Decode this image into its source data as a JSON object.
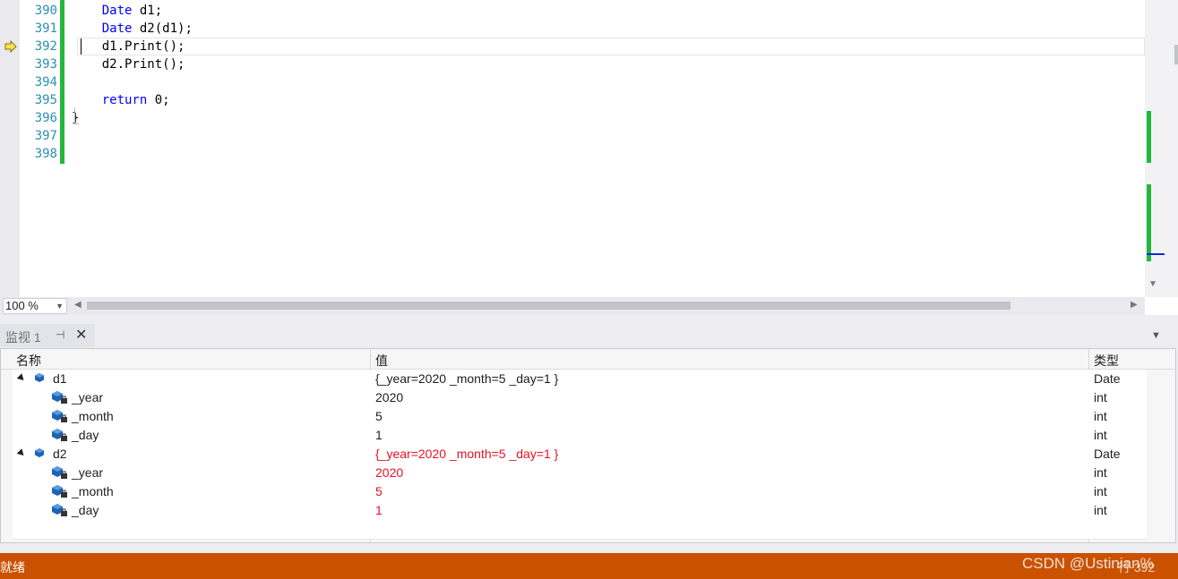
{
  "editor": {
    "line_numbers": [
      "390",
      "391",
      "392",
      "393",
      "394",
      "395",
      "396",
      "397",
      "398"
    ],
    "code": {
      "l390_kw": "Date",
      "l390_rest": " d1;",
      "l391_kw": "Date",
      "l391_rest": " d2(d1);",
      "l392": "d1.Print();",
      "l393": "d2.Print();",
      "l395_kw": "return",
      "l395_rest": " 0;",
      "l396": "}"
    },
    "current_line": "392",
    "zoom": "100 %"
  },
  "watch": {
    "tab_title": "监视 1",
    "headers": {
      "name": "名称",
      "value": "值",
      "type": "类型"
    },
    "rows": [
      {
        "name": "d1",
        "value": "{_year=2020 _month=5 _day=1 }",
        "type": "Date",
        "changed": false
      },
      {
        "name": "_year",
        "value": "2020",
        "type": "int",
        "changed": false
      },
      {
        "name": "_month",
        "value": "5",
        "type": "int",
        "changed": false
      },
      {
        "name": "_day",
        "value": "1",
        "type": "int",
        "changed": false
      },
      {
        "name": "d2",
        "value": "{_year=2020 _month=5 _day=1 }",
        "type": "Date",
        "changed": true
      },
      {
        "name": "_year",
        "value": "2020",
        "type": "int",
        "changed": true
      },
      {
        "name": "_month",
        "value": "5",
        "type": "int",
        "changed": true
      },
      {
        "name": "_day",
        "value": "1",
        "type": "int",
        "changed": true
      }
    ]
  },
  "status": {
    "text": "就绪",
    "line": "行 392",
    "watermark": "CSDN @Ustinian%"
  },
  "colors": {
    "status_bar": "#ca5100",
    "changed_value": "#e81123",
    "keyword": "#0000ff",
    "line_number": "#2b91af",
    "change_bar": "#22b83c"
  },
  "icons": {
    "execution_pointer": "yellow-arrow-icon",
    "object": "blue-cube-icon",
    "member": "private-field-icon"
  }
}
